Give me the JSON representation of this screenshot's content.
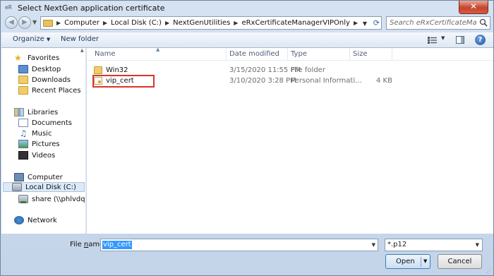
{
  "window": {
    "title": "Select NextGen application certificate",
    "app_icon_text": "eR",
    "close_label": "✕"
  },
  "address": {
    "breadcrumbs": [
      "Computer",
      "Local Disk (C:)",
      "NextGenUtilities",
      "eRxCertificateManagerVIPOnly"
    ]
  },
  "search": {
    "placeholder": "Search eRxCertificateManager..."
  },
  "toolbar": {
    "organize_label": "Organize",
    "new_folder_label": "New folder",
    "help_label": "?"
  },
  "nav": {
    "favorites": {
      "label": "Favorites",
      "items": [
        "Desktop",
        "Downloads",
        "Recent Places"
      ]
    },
    "libraries": {
      "label": "Libraries",
      "items": [
        "Documents",
        "Music",
        "Pictures",
        "Videos"
      ]
    },
    "computer": {
      "label": "Computer",
      "items": [
        "Local Disk (C:)",
        "share (\\\\phlvdqafile)"
      ]
    },
    "network": {
      "label": "Network"
    },
    "selected": "Local Disk (C:)"
  },
  "columns": {
    "name": "Name",
    "date_modified": "Date modified",
    "type": "Type",
    "size": "Size"
  },
  "files": [
    {
      "name": "Win32",
      "date_modified": "3/15/2020 11:55 PM",
      "type": "File folder",
      "size": "",
      "icon": "folder-icon"
    },
    {
      "name": "vip_cert",
      "date_modified": "3/10/2020 3:28 PM",
      "type": "Personal Informati...",
      "size": "4 KB",
      "icon": "certificate-icon"
    }
  ],
  "bottom": {
    "file_name_label_prefix": "File ",
    "file_name_label_hotkey": "n",
    "file_name_label_suffix": "ame:",
    "file_name_value": "vip_cert",
    "filter_value": "*.p12",
    "open_label": "Open",
    "cancel_label": "Cancel"
  },
  "colors": {
    "highlight_border": "#d9342c",
    "selection_blue": "#3399ff",
    "close_red": "#c7442c"
  }
}
